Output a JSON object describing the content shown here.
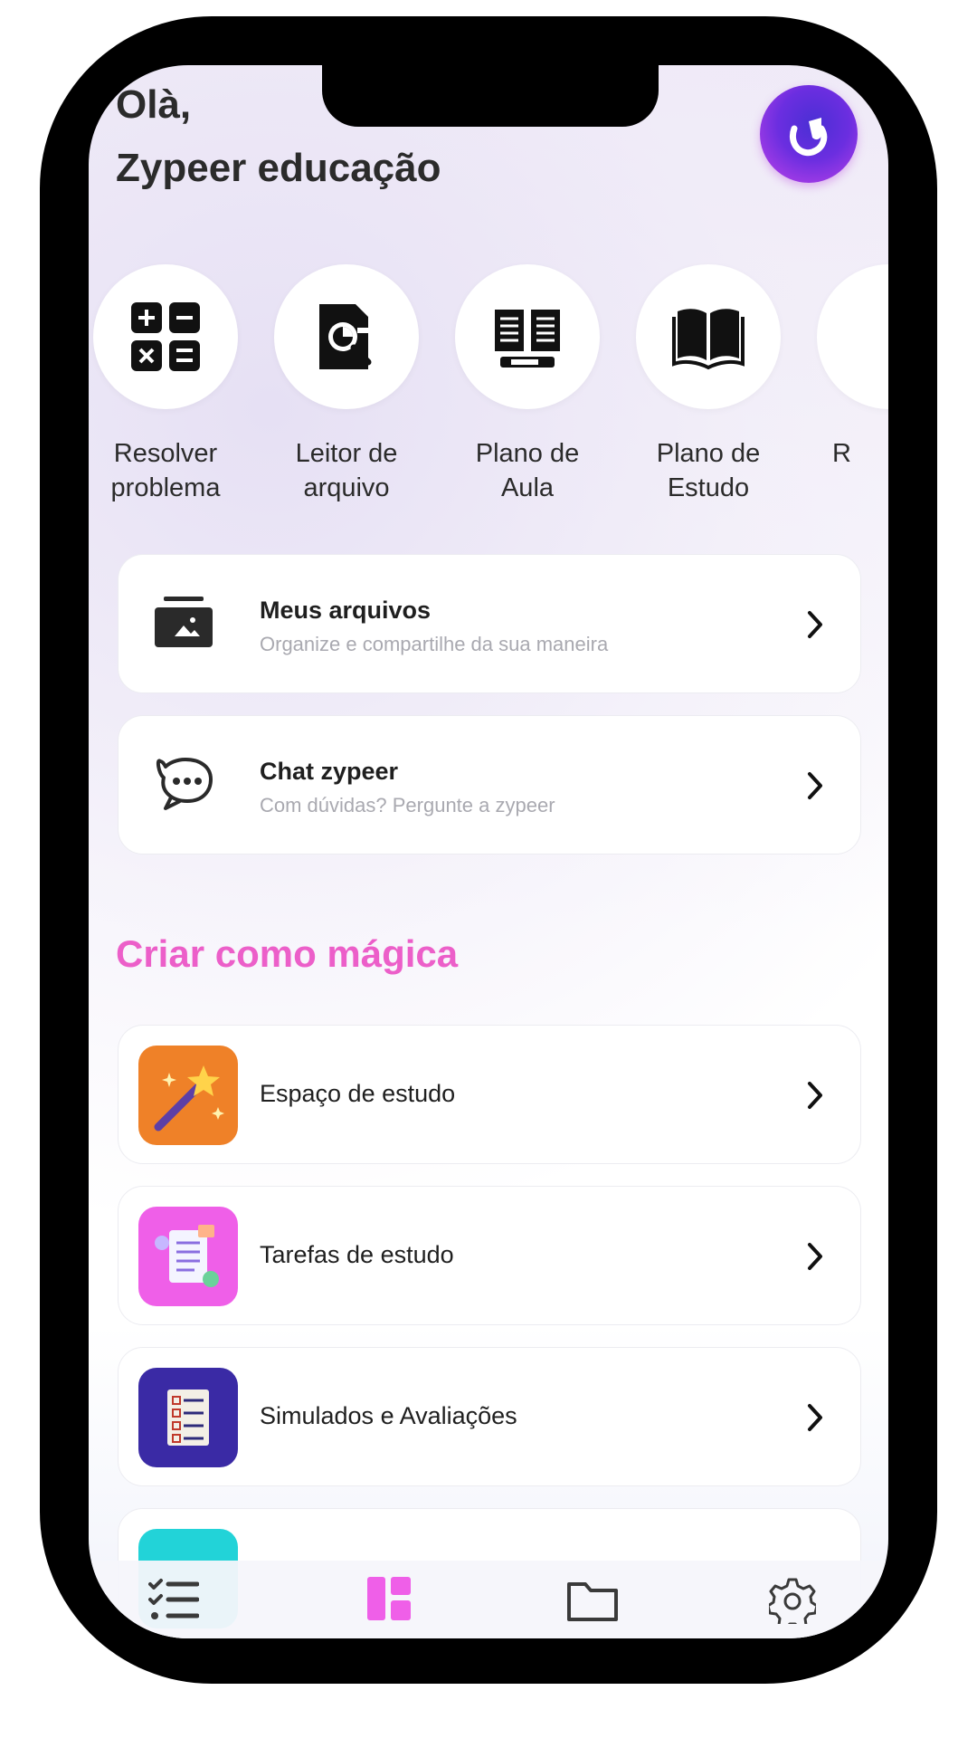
{
  "greeting": {
    "hello": "Olà,",
    "name": "Zypeer educação"
  },
  "shortcuts": [
    {
      "label": "Resolver\nproblema",
      "icon": "calculator-icon"
    },
    {
      "label": "Leitor de\narquivo",
      "icon": "file-chart-search-icon"
    },
    {
      "label": "Plano de\nAula",
      "icon": "open-book-pencil-icon"
    },
    {
      "label": "Plano de\nEstudo",
      "icon": "open-book-icon"
    },
    {
      "label": "R",
      "icon": "partial-shortcut"
    }
  ],
  "cards": [
    {
      "title": "Meus arquivos",
      "subtitle": "Organize e compartilhe da sua maneira",
      "icon": "image-folder-icon"
    },
    {
      "title": "Chat zypeer",
      "subtitle": "Com dúvidas? Pergunte a zypeer",
      "icon": "chat-bubble-icon"
    }
  ],
  "magic": {
    "title": "Criar como mágica",
    "items": [
      {
        "title": "Espaço de estudo",
        "icon": "magic-wand-icon",
        "color": "#ef8128"
      },
      {
        "title": "Tarefas de estudo",
        "icon": "task-list-icon",
        "color": "#ef5fe8"
      },
      {
        "title": "Simulados e Avaliações",
        "icon": "checklist-icon",
        "color": "#3a2aa5"
      },
      {
        "title": "",
        "icon": "partial-item-icon",
        "color": "#22d3d8"
      }
    ]
  },
  "nav": {
    "items": [
      "tasks-icon",
      "dashboard-icon",
      "folder-icon",
      "settings-icon"
    ],
    "active_color": "#ef5fe8"
  }
}
